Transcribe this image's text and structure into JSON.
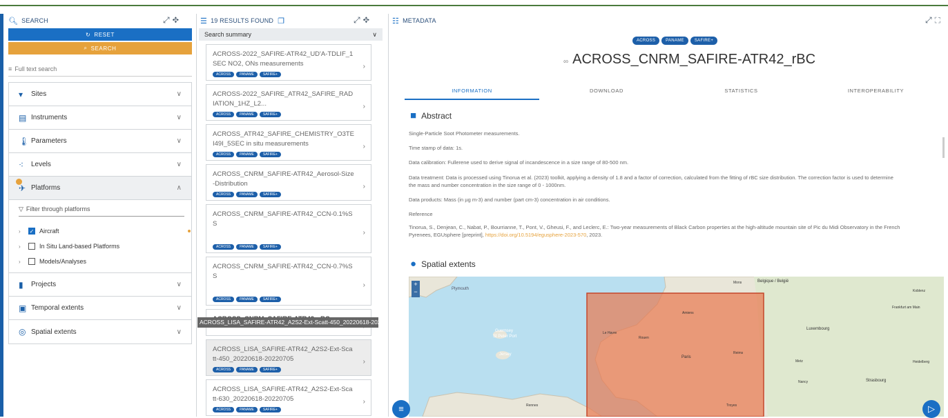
{
  "search_panel": {
    "title": "SEARCH",
    "reset": "RESET",
    "search": "SEARCH",
    "fulltext": "Full text search",
    "facets": [
      {
        "label": "Sites",
        "icon": "pin-icon"
      },
      {
        "label": "Instruments",
        "icon": "instrument-icon"
      },
      {
        "label": "Parameters",
        "icon": "thermometer-icon"
      },
      {
        "label": "Levels",
        "icon": "levels-icon"
      }
    ],
    "platforms": {
      "label": "Platforms",
      "filter_placeholder": "Filter through platforms",
      "tree": [
        {
          "label": "Aircraft",
          "checked": true
        },
        {
          "label": "In Situ Land-based Platforms",
          "checked": false
        },
        {
          "label": "Models/Analyses",
          "checked": false
        }
      ]
    },
    "facets_after": [
      {
        "label": "Projects",
        "icon": "file-icon"
      },
      {
        "label": "Temporal extents",
        "icon": "calendar-icon"
      },
      {
        "label": "Spatial extents",
        "icon": "globe-icon"
      }
    ]
  },
  "results_panel": {
    "title": "19 RESULTS FOUND",
    "summary": "Search summary",
    "tooltip": "ACROSS_LISA_SAFIRE-ATR42_A2S2-Ext-Scatt-450_20220618-20220705",
    "results": [
      {
        "title": "ACROSS-2022_SAFIRE-ATR42_UD'A-TDLIF_1SEC NO2, ONs measurements",
        "tags": [
          "ACROSS",
          "PANAME",
          "SAFIRE+"
        ]
      },
      {
        "title": "ACROSS-2022_SAFIRE_ATR42_SAFIRE_RADIATION_1HZ_L2...",
        "tags": [
          "ACROSS",
          "PANAME",
          "SAFIRE+"
        ]
      },
      {
        "title": "ACROSS_ATR42_SAFIRE_CHEMISTRY_O3TEI49I_5SEC in situ measurements",
        "tags": [
          "ACROSS",
          "PANAME",
          "SAFIRE+"
        ]
      },
      {
        "title": "ACROSS_CNRM_SAFIRE-ATR42_Aerosol-Size-Distribution",
        "tags": [
          "ACROSS",
          "PANAME",
          "SAFIRE+"
        ]
      },
      {
        "title": "ACROSS_CNRM_SAFIRE-ATR42_CCN-0.1%SS",
        "tags": [
          "ACROSS",
          "PANAME",
          "SAFIRE+"
        ]
      },
      {
        "title": "ACROSS_CNRM_SAFIRE-ATR42_CCN-0.7%SS",
        "tags": [
          "ACROSS",
          "PANAME",
          "SAFIRE+"
        ]
      },
      {
        "title": "ACROSS_CNRM_SAFIRE-ATR42_rBC",
        "tags": []
      },
      {
        "title": "ACROSS_LISA_SAFIRE-ATR42_A2S2-Ext-Scatt-450_20220618-20220705",
        "tags": [
          "ACROSS",
          "PANAME",
          "SAFIRE+"
        ]
      },
      {
        "title": "ACROSS_LISA_SAFIRE-ATR42_A2S2-Ext-Scatt-630_20220618-20220705",
        "tags": [
          "ACROSS",
          "PANAME",
          "SAFIRE+"
        ]
      }
    ]
  },
  "metadata_panel": {
    "title": "METADATA",
    "tags": [
      "ACROSS",
      "PANAME",
      "SAFIRE+"
    ],
    "dataset_title": "ACROSS_CNRM_SAFIRE-ATR42_rBC",
    "tabs": [
      "INFORMATION",
      "DOWNLOAD",
      "STATISTICS",
      "INTEROPERABILITY"
    ],
    "abstract_heading": "Abstract",
    "abstract": [
      "Single-Particle Soot Photometer measurements.",
      "Time stamp of data: 1s.",
      "Data calibration: Fullerene used to derive signal of incandescence in a size range of 80-500 nm.",
      "Data treatment: Data is processed using Tinorua et al. (2023) toolkit, applying a density of 1.8 and a factor of correction, calculated from the fitting of rBC size distribution. The correction factor is used to determine",
      "the mass and number concentration in the size range of 0 - 1000nm.",
      "Data products: Mass (in µg m-3) and number (part cm-3) concentration in air conditions.",
      "Reference",
      "Tinorua, S., Denjean, C., Nabat, P., Bourrianne, T., Pont, V., Gheusi, F., and Leclerc, E.: Two-year measurements of Black Carbon properties at the high-altitude mountain site of Pic du Midi Observatory in the French",
      "Pyrenees, EGUsphere [preprint], "
    ],
    "reference_link": "https://doi.org/10.5194/egusphere-2023-570",
    "reference_tail": ", 2023.",
    "spatial_heading": "Spatial extents",
    "map_labels": [
      "Plymouth",
      "Guernsey",
      "St Peter Port",
      "Jersey",
      "Le Havre",
      "Rouen",
      "Amiens",
      "Paris",
      "Reims",
      "Troyes",
      "Rennes",
      "Luxembourg",
      "Metz",
      "Nancy",
      "Strasbourg",
      "Frankfurt am Main",
      "Koblenz",
      "Belgique / België",
      "Mons",
      "Heidelberg"
    ]
  }
}
